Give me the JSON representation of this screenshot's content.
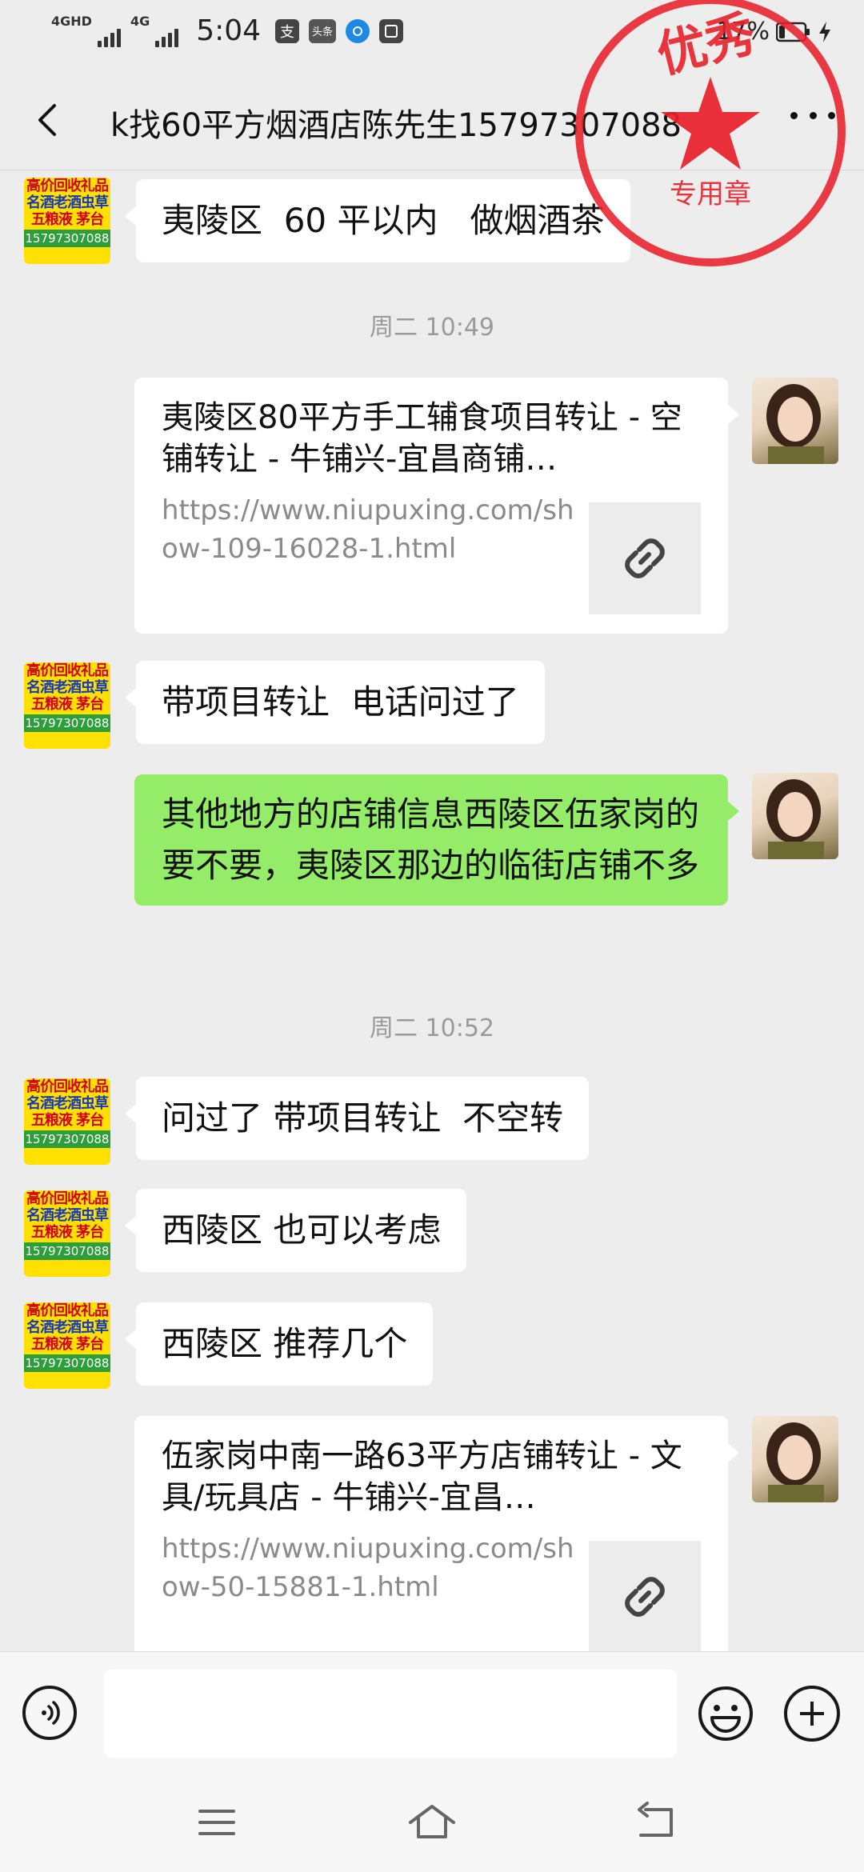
{
  "status_bar": {
    "network_1": "4GHD",
    "network_2": "4G",
    "time": "5:04",
    "icon_alipay": "支",
    "icon_toutiao": "头条",
    "battery_percent": "17%",
    "icons": [
      "signal-icon",
      "alipay-icon",
      "toutiao-icon",
      "wechat-pay-icon",
      "album-icon",
      "battery-icon",
      "charging-icon"
    ]
  },
  "header": {
    "title": "k找60平方烟酒店陈先生15797307088",
    "back_icon": "chevron-left-icon",
    "more_icon": "more-icon"
  },
  "stamp": {
    "text_top": "优秀",
    "text_bottom": "专用章",
    "color": "#e8202a"
  },
  "contact_avatar": {
    "line1": "高价回收礼品",
    "line2": "名酒老酒虫草",
    "line3": "五粮液 茅台",
    "phone": "15797307088",
    "colors": {
      "background": "#ffe000",
      "red": "#d0021b",
      "blue": "#1538b5",
      "green": "#2e9e3a"
    }
  },
  "messages": [
    {
      "type": "text",
      "side": "left",
      "text": "夷陵区  60 平以内   做烟酒茶"
    },
    {
      "type": "timestamp",
      "text": "周二 10:49"
    },
    {
      "type": "link",
      "side": "right",
      "title": "夷陵区80平方手工辅食项目转让 - 空铺转让 - 牛铺兴-宜昌商铺…",
      "url": "https://www.niupuxing.com/show-109-16028-1.html"
    },
    {
      "type": "text",
      "side": "left",
      "text": "带项目转让  电话问过了"
    },
    {
      "type": "text",
      "side": "right",
      "text": "其他地方的店铺信息西陵区伍家岗的要不要，夷陵区那边的临街店铺不多"
    },
    {
      "type": "timestamp",
      "text": "周二 10:52"
    },
    {
      "type": "text",
      "side": "left",
      "text": "问过了 带项目转让  不空转"
    },
    {
      "type": "text",
      "side": "left",
      "text": "西陵区 也可以考虑"
    },
    {
      "type": "text",
      "side": "left",
      "text": "西陵区 推荐几个"
    },
    {
      "type": "link",
      "side": "right",
      "title": "伍家岗中南一路63平方店铺转让 - 文具/玩具店 - 牛铺兴-宜昌…",
      "url": "https://www.niupuxing.com/show-50-15881-1.html"
    }
  ],
  "input_bar": {
    "voice_icon": "voice-icon",
    "emoji_icon": "emoji-icon",
    "plus_icon": "plus-icon",
    "message_value": ""
  },
  "nav_bar": {
    "icons": [
      "menu-icon",
      "home-icon",
      "back-icon"
    ]
  },
  "colors": {
    "background": "#ededed",
    "bubble_self": "#95ec69",
    "bubble_other": "#ffffff",
    "timestamp": "#9a9a9a",
    "link_url": "#8a8a8a"
  }
}
